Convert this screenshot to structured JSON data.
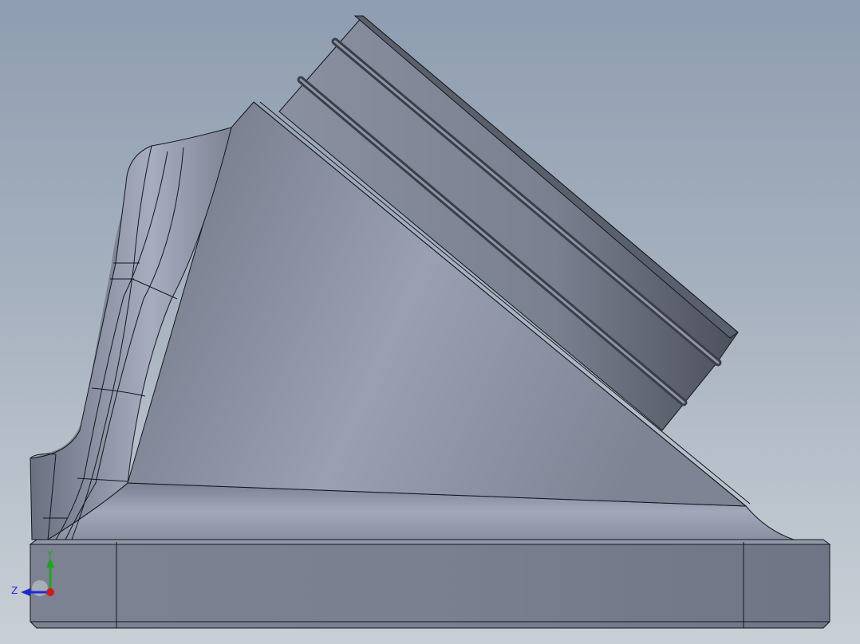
{
  "viewport": {
    "background_top": "#8e9db0",
    "background_bottom": "#c9cfd6"
  },
  "model": {
    "body_color": "#848a9a",
    "edge_color": "#14161c",
    "highlight_color": "#a4aabc",
    "shadow_color": "#4c505b"
  },
  "triad": {
    "y_label": "Y",
    "z_label": "Z",
    "y_color": "#1ea51e",
    "z_color": "#1b2ad6",
    "origin_color": "#d21a1a"
  }
}
